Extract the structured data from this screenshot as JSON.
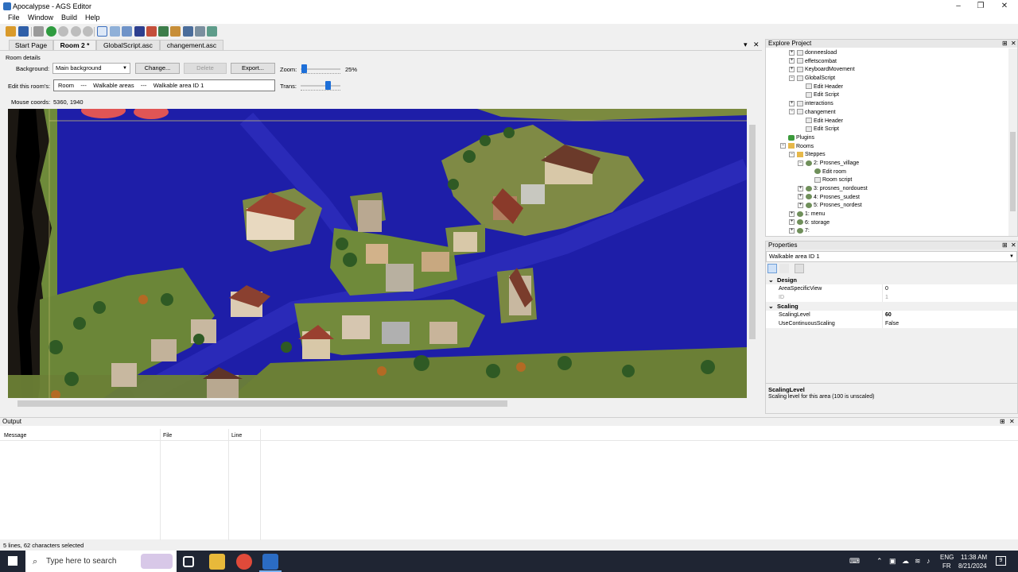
{
  "window": {
    "title": "Apocalypse - AGS Editor",
    "min": "–",
    "max": "❐",
    "close": "✕"
  },
  "menu": [
    "File",
    "Window",
    "Build",
    "Help"
  ],
  "doc_tabs": [
    {
      "label": "Start Page",
      "active": false
    },
    {
      "label": "Room 2 *",
      "active": true
    },
    {
      "label": "GlobalScript.asc *",
      "active": false
    },
    {
      "label": "changement.asc",
      "active": false
    }
  ],
  "doc_tab_controls": {
    "dropdown": "▾",
    "close": "✕"
  },
  "room_details": {
    "header": "Room details",
    "background_label": "Background:",
    "background_value": "Main background",
    "change_button": "Change...",
    "delete_button": "Delete",
    "export_button": "Export...",
    "zoom_label": "Zoom:",
    "zoom_value": "25%",
    "edit_label": "Edit this room's:",
    "edit_path": "Room    ---    Walkable areas    ---    Walkable area ID 1",
    "trans_label": "Trans:",
    "mouse_label": "Mouse coords:",
    "mouse_value": "5360, 1940"
  },
  "explore": {
    "title": "Explore Project",
    "pin": "⊞",
    "close": "✕",
    "items": [
      {
        "label": "donneesload",
        "level": 1,
        "type": "script",
        "exp": "+"
      },
      {
        "label": "effetscombat",
        "level": 1,
        "type": "script",
        "exp": "+"
      },
      {
        "label": "KeyboardMovement",
        "level": 1,
        "type": "script",
        "exp": "+"
      },
      {
        "label": "GlobalScript",
        "level": 1,
        "type": "script",
        "exp": "−"
      },
      {
        "label": "Edit Header",
        "level": 2,
        "type": "script",
        "exp": ""
      },
      {
        "label": "Edit Script",
        "level": 2,
        "type": "script",
        "exp": ""
      },
      {
        "label": "interactions",
        "level": 1,
        "type": "script",
        "exp": "+"
      },
      {
        "label": "changement",
        "level": 1,
        "type": "script",
        "exp": "−"
      },
      {
        "label": "Edit Header",
        "level": 2,
        "type": "script",
        "exp": ""
      },
      {
        "label": "Edit Script",
        "level": 2,
        "type": "script",
        "exp": ""
      },
      {
        "label": "Plugins",
        "level": 0,
        "type": "plug",
        "exp": ""
      },
      {
        "label": "Rooms",
        "level": 0,
        "type": "folder",
        "exp": "−"
      },
      {
        "label": "Steppes",
        "level": 1,
        "type": "folder",
        "exp": "−"
      },
      {
        "label": "2: Prosnes_village",
        "level": 2,
        "type": "room",
        "exp": "−"
      },
      {
        "label": "Edit room",
        "level": 3,
        "type": "room",
        "exp": ""
      },
      {
        "label": "Room script",
        "level": 3,
        "type": "script",
        "exp": ""
      },
      {
        "label": "3: prosnes_nordouest",
        "level": 2,
        "type": "room",
        "exp": "+"
      },
      {
        "label": "4: Prosnes_sudest",
        "level": 2,
        "type": "room",
        "exp": "+"
      },
      {
        "label": "5: Prosnes_nordest",
        "level": 2,
        "type": "room",
        "exp": "+"
      },
      {
        "label": "1: menu",
        "level": 1,
        "type": "room",
        "exp": "+"
      },
      {
        "label": "6: storage",
        "level": 1,
        "type": "room",
        "exp": "+"
      },
      {
        "label": "7:",
        "level": 1,
        "type": "room",
        "exp": "+"
      }
    ]
  },
  "properties": {
    "title": "Properties",
    "object": "Walkable area ID 1",
    "categories": [
      {
        "name": "Design",
        "rows": [
          {
            "name": "AreaSpecificView",
            "value": "0",
            "grey": false,
            "bold": false
          },
          {
            "name": "ID",
            "value": "1",
            "grey": true,
            "bold": false
          }
        ]
      },
      {
        "name": "Scaling",
        "rows": [
          {
            "name": "ScalingLevel",
            "value": "60",
            "grey": false,
            "bold": true
          },
          {
            "name": "UseContinuousScaling",
            "value": "False",
            "grey": false,
            "bold": false
          }
        ]
      }
    ],
    "help_title": "ScalingLevel",
    "help_text": "Scaling level for this area (100 is unscaled)"
  },
  "output": {
    "title": "Output",
    "columns": [
      "Message",
      "File",
      "Line"
    ]
  },
  "status": "5 lines, 62 characters selected",
  "taskbar": {
    "search_placeholder": "Type here to search",
    "lang1": "ENG",
    "lang2": "FR",
    "time": "11:38 AM",
    "date": "8/21/2024",
    "notif": "9"
  },
  "colors": {
    "accent": "#1d6fd8",
    "walkable_overlay": "#1e1ea8",
    "grass": "#6e8a3a",
    "taskbar": "#1f2533"
  }
}
